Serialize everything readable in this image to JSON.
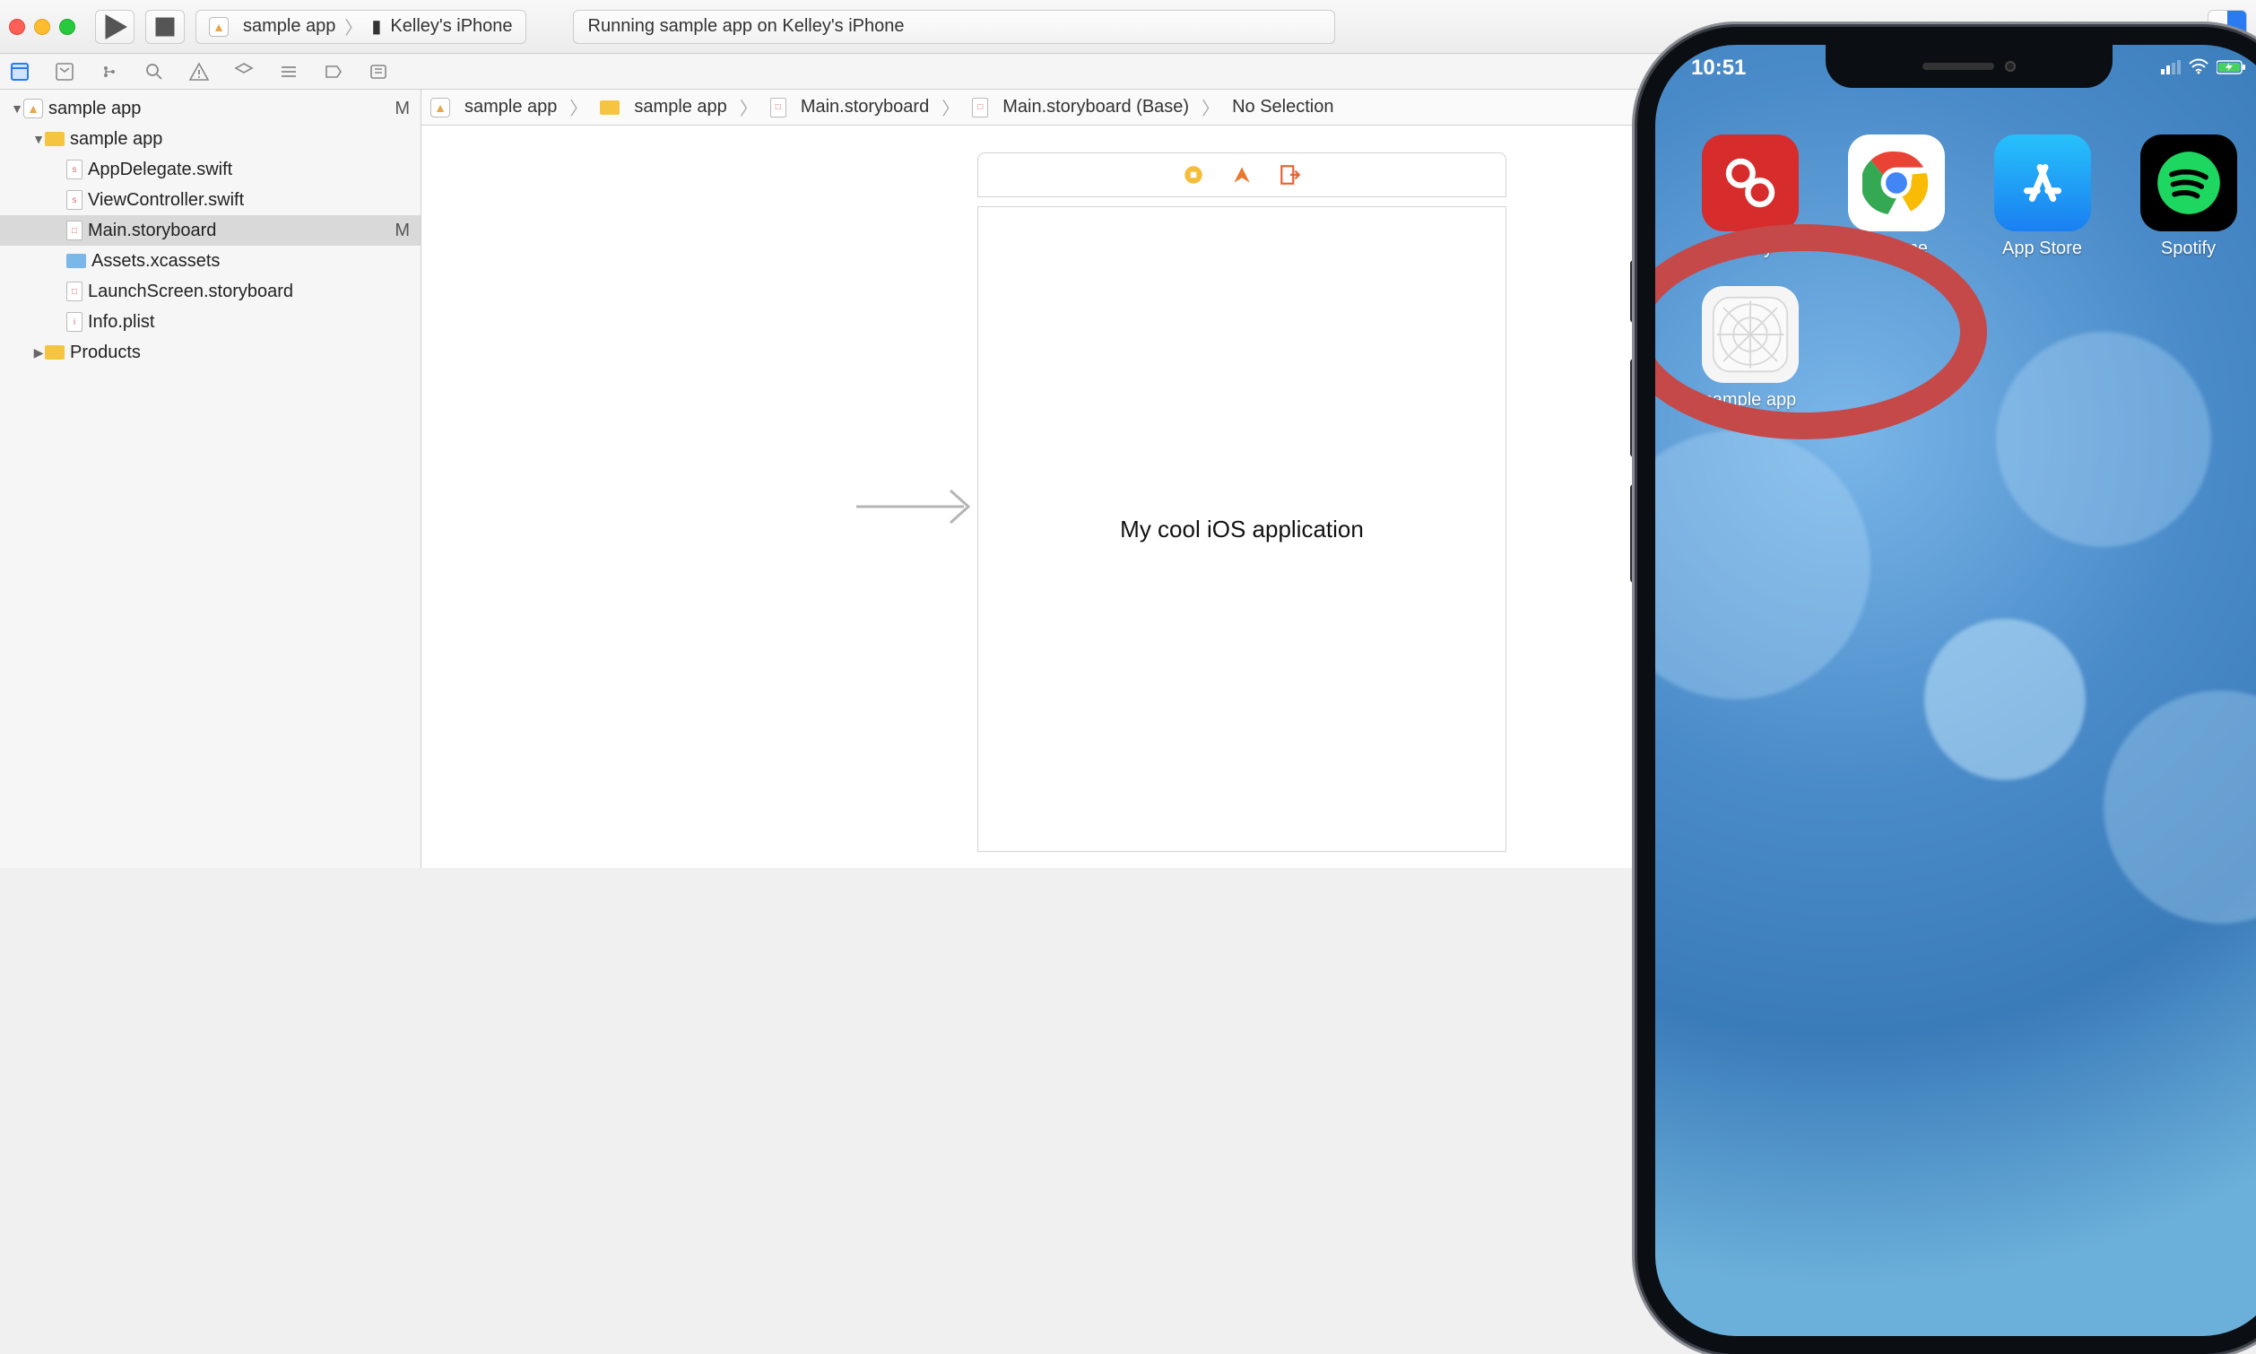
{
  "toolbar": {
    "scheme_app": "sample app",
    "scheme_device": "Kelley's iPhone",
    "status": "Running sample app on Kelley's iPhone"
  },
  "breadcrumb": {
    "items": [
      "sample app",
      "sample app",
      "Main.storyboard",
      "Main.storyboard (Base)",
      "No Selection"
    ]
  },
  "navigator": {
    "root": {
      "name": "sample app",
      "status": "M"
    },
    "group": {
      "name": "sample app"
    },
    "files": [
      {
        "name": "AppDelegate.swift"
      },
      {
        "name": "ViewController.swift"
      },
      {
        "name": "Main.storyboard",
        "status": "M",
        "selected": true
      },
      {
        "name": "Assets.xcassets"
      },
      {
        "name": "LaunchScreen.storyboard"
      },
      {
        "name": "Info.plist"
      }
    ],
    "products": "Products"
  },
  "storyboard": {
    "label_text": "My cool iOS application"
  },
  "iphone": {
    "time": "10:51",
    "apps_row1": [
      {
        "label": "Authy",
        "bg": "#d62c2c"
      },
      {
        "label": "Chrome",
        "bg": "#ffffff"
      },
      {
        "label": "App Store",
        "bg": "#1a9ff1"
      },
      {
        "label": "Spotify",
        "bg": "#000000"
      }
    ],
    "apps_row2": [
      {
        "label": "sample app",
        "bg": "#f0f0f0"
      }
    ]
  }
}
